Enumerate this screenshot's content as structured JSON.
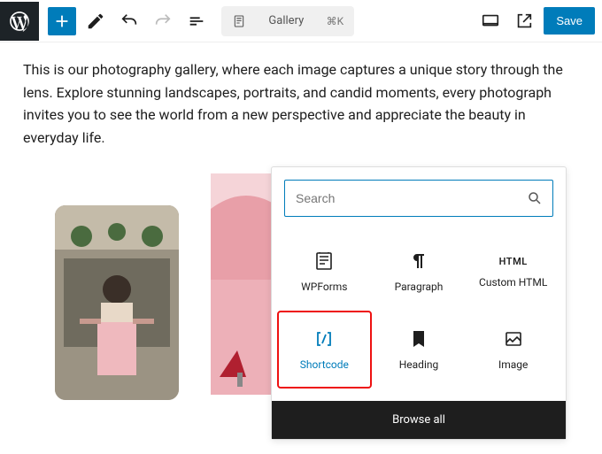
{
  "toolbar": {
    "title_label": "Gallery",
    "shortcut": "⌘K",
    "save_label": "Save"
  },
  "body_text": "This is our photography gallery, where each image captures a unique story through the lens. Explore stunning landscapes, portraits, and candid moments, every photograph invites you to see the world from a new perspective and appreciate the beauty in everyday life.",
  "inserter": {
    "search_placeholder": "Search",
    "blocks": {
      "wpforms": "WPForms",
      "paragraph": "Paragraph",
      "custom_html": "Custom HTML",
      "shortcode": "Shortcode",
      "heading": "Heading",
      "image": "Image"
    },
    "browse_all": "Browse all",
    "html_icon_text": "HTML"
  }
}
